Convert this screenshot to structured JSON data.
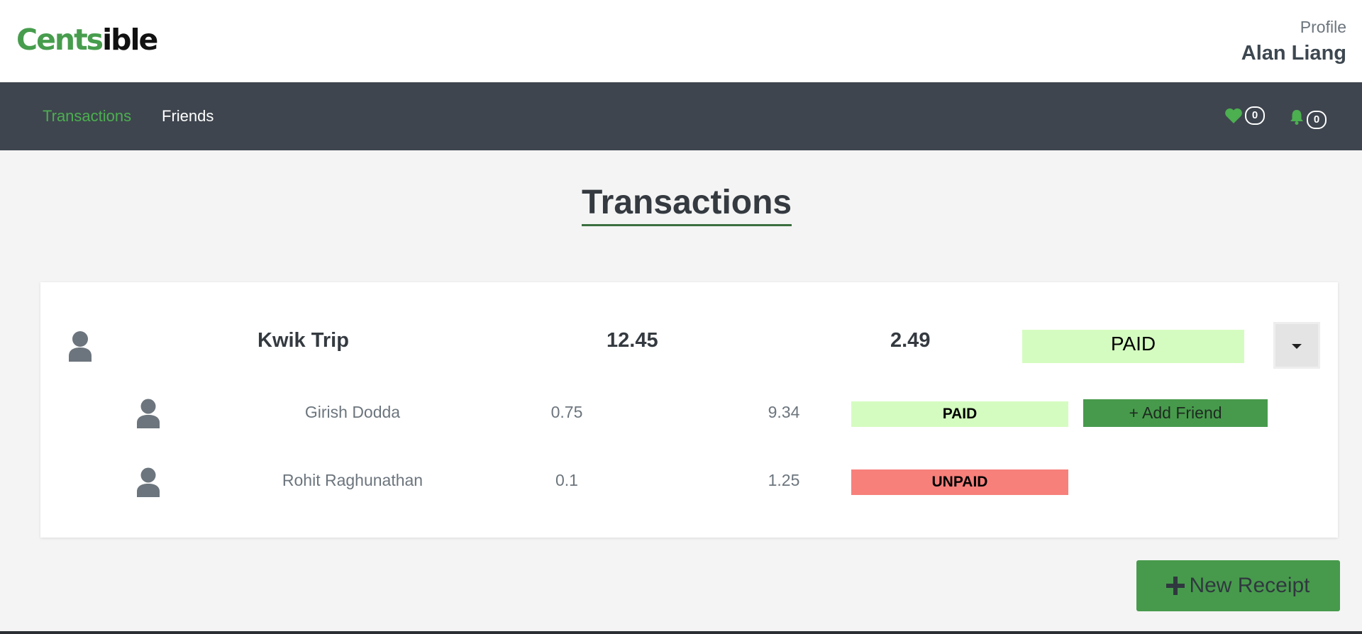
{
  "brand": {
    "part1": "Cents",
    "part2": "ible"
  },
  "profile": {
    "label": "Profile",
    "name": "Alan Liang"
  },
  "nav": {
    "transactions": "Transactions",
    "friends": "Friends",
    "likes_count": "0",
    "notifications_count": "0",
    "likes_icon": "heart-icon",
    "notifications_icon": "bell-icon"
  },
  "page": {
    "title": "Transactions"
  },
  "transaction": {
    "name": "Kwik Trip",
    "total": "12.45",
    "my_share": "2.49",
    "status": "PAID",
    "dropdown_icon": "caret-down-icon",
    "participants": [
      {
        "name": "Girish Dodda",
        "amount": "0.75",
        "percent": "9.34",
        "status": "PAID",
        "action": "+ Add Friend"
      },
      {
        "name": "Rohit Raghunathan",
        "amount": "0.1",
        "percent": "1.25",
        "status": "UNPAID"
      }
    ]
  },
  "new_receipt": {
    "icon": "plus-icon",
    "label": "New Receipt"
  },
  "colors": {
    "brand_green": "#479d4d",
    "navbar": "#3e454e",
    "active_nav": "#4caf50",
    "paid": "#d5fcc0",
    "unpaid": "#f7807b",
    "button_green": "#479a4c"
  }
}
